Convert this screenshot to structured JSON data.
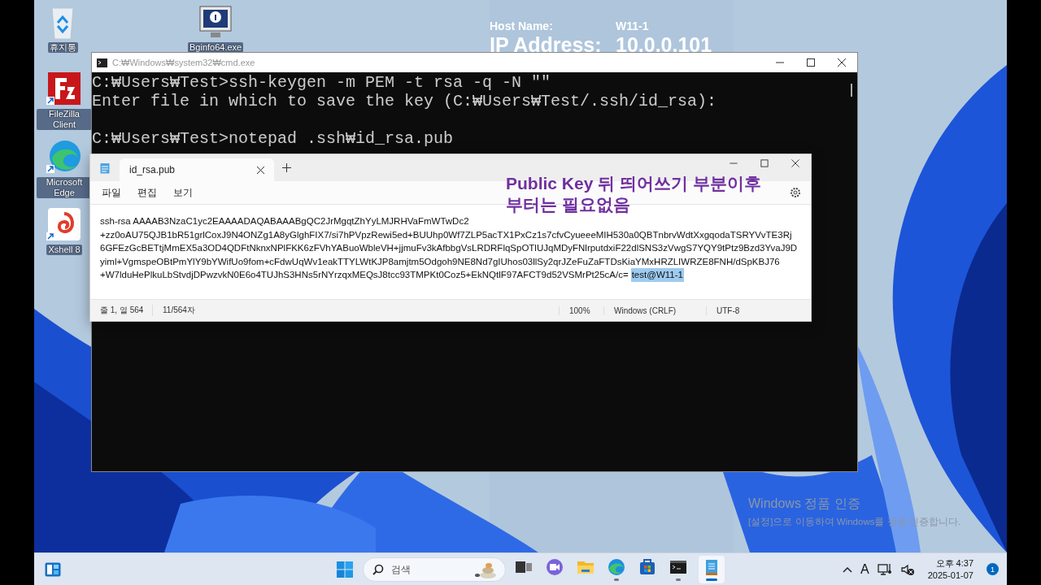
{
  "desktop_icons": [
    {
      "label": "휴지통",
      "kind": "recycle"
    },
    {
      "label": "Bginfo64.exe",
      "kind": "bginfo"
    },
    {
      "label": "FileZilla Client",
      "kind": "filezilla"
    },
    {
      "label": "Microsoft Edge",
      "kind": "edge"
    },
    {
      "label": "Xshell 8",
      "kind": "xshell"
    }
  ],
  "bginfo": {
    "host_label": "Host Name:",
    "host_value": "W11-1",
    "ip_label": "IP Address:",
    "ip_value": "10.0.0.101"
  },
  "cmd_window": {
    "title": "C:₩Windows₩system32₩cmd.exe",
    "blocks": [
      [
        "C:₩Users₩Test>ssh-keygen -m PEM -t rsa -q -N \"\"",
        "Enter file in which to save the key (C:₩Users₩Test/.ssh/id_rsa):"
      ],
      [
        "C:₩Users₩Test>notepad .ssh₩id_rsa.pub"
      ]
    ]
  },
  "notepad": {
    "tab": {
      "title": "id_rsa.pub",
      "selected": true
    },
    "menu": [
      "파일",
      "편집",
      "보기"
    ],
    "lines": [
      "ssh-rsa AAAAB3NzaC1yc2EAAAADAQABAAABgQC2JrMgqtZhYyLMJRHVaFmWTwDc2",
      "+zz0oAU75QJB1bR51grlCoxJ9N4ONZg1A8yGlghFIX7/si7hPVpzRewi5ed+BUUhp0Wf7ZLP5acTX1PxCz1s7cfvCyueeeMIH530a0QBTnbrvWdtXxgqodaTSRYVvTE3Rj",
      "6GFEzGcBETtjMmEX5a3OD4QDFtNknxNPlFKK6zFVhYABuoWbleVH+jjmuFv3kAfbbgVsLRDRFlqSpOTlUJqMDyFNlrputdxiF22dlSNS3zVwgS7YQY9tPtz9Bzd3YvaJ9D",
      "yiml+VgmspeOBtPmYlY9bYWifUo9fom+cFdwUqWv1eakTTYLWtKJP8amjtm5Odgoh9NE8Nd7gIUhos03llSy2qrJZeFuZaFTDsKiaYMxHRZLIWRZE8FNH/dSpKBJ76",
      "+W7lduHePlkuLbStvdjDPwzvkN0E6o4TUJhS3HNs5rNYrzqxMEQsJ8tcc93TMPKt0Coz5+EkNQtlF97AFCT9d52VSMrPt25cA/c="
    ],
    "selected_text": "test@W11-1",
    "status": {
      "position": "줄 1, 열 564",
      "chars": "11/564자",
      "zoom": "100%",
      "line_ending": "Windows (CRLF)",
      "encoding": "UTF-8"
    }
  },
  "annotation": [
    "Public Key 뒤 띄어쓰기 부분이후",
    "부터는 필요없음"
  ],
  "activation": {
    "title": "Windows 정품 인증",
    "message": "[설정]으로 이동하여 Windows를 정품 인증합니다."
  },
  "taskbar": {
    "search_placeholder": "검색",
    "apps": [
      {
        "kind": "taskview",
        "running": false,
        "selected": false
      },
      {
        "kind": "chat",
        "running": false,
        "selected": false
      },
      {
        "kind": "explorer",
        "running": false,
        "selected": false
      },
      {
        "kind": "edge",
        "running": true,
        "selected": false
      },
      {
        "kind": "store",
        "running": false,
        "selected": false
      },
      {
        "kind": "terminal",
        "running": true,
        "selected": false
      },
      {
        "kind": "notepad",
        "running": true,
        "selected": true
      }
    ],
    "input_indicator": "A",
    "time": "오후 4:37",
    "date": "2025-01-07",
    "notification_count": "1"
  }
}
